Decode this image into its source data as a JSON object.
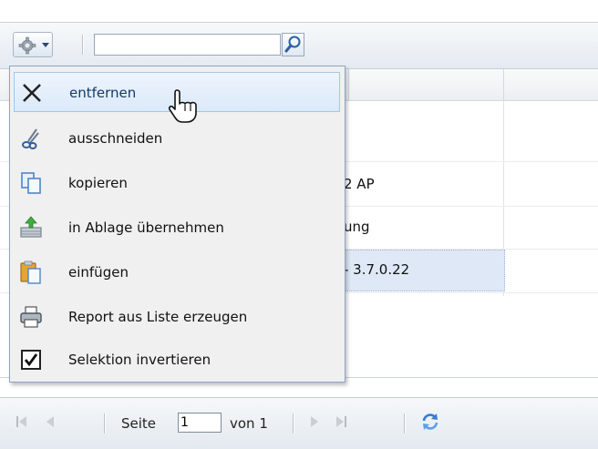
{
  "toolbar": {
    "search_value": "",
    "search_placeholder": ""
  },
  "grid": {
    "rows": [
      {
        "text": ""
      },
      {
        "text": "2 AP"
      },
      {
        "text": "ung"
      },
      {
        "text": "- 3.7.0.22"
      }
    ],
    "selected_row_index": 3
  },
  "context_menu": {
    "items": [
      {
        "label": "entfernen",
        "icon": "close-x-icon",
        "active": true
      },
      {
        "label": "ausschneiden",
        "icon": "scissors-icon",
        "active": false
      },
      {
        "label": "kopieren",
        "icon": "copy-icon",
        "active": false
      },
      {
        "label": "in Ablage übernehmen",
        "icon": "add-to-clipboard-icon",
        "active": false
      },
      {
        "label": "einfügen",
        "icon": "paste-icon",
        "active": false
      },
      {
        "label": "Report aus Liste erzeugen",
        "icon": "printer-icon",
        "active": false
      },
      {
        "label": "Selektion invertieren",
        "icon": "checkbox-checked-icon",
        "active": false
      }
    ]
  },
  "pager": {
    "page_label": "Seite",
    "current_page": "1",
    "of_label": "von 1"
  },
  "colors": {
    "menu_highlight": "#dbe9f9",
    "selection_row": "#dfe8f6",
    "accent_blue": "#2b6cb8"
  }
}
